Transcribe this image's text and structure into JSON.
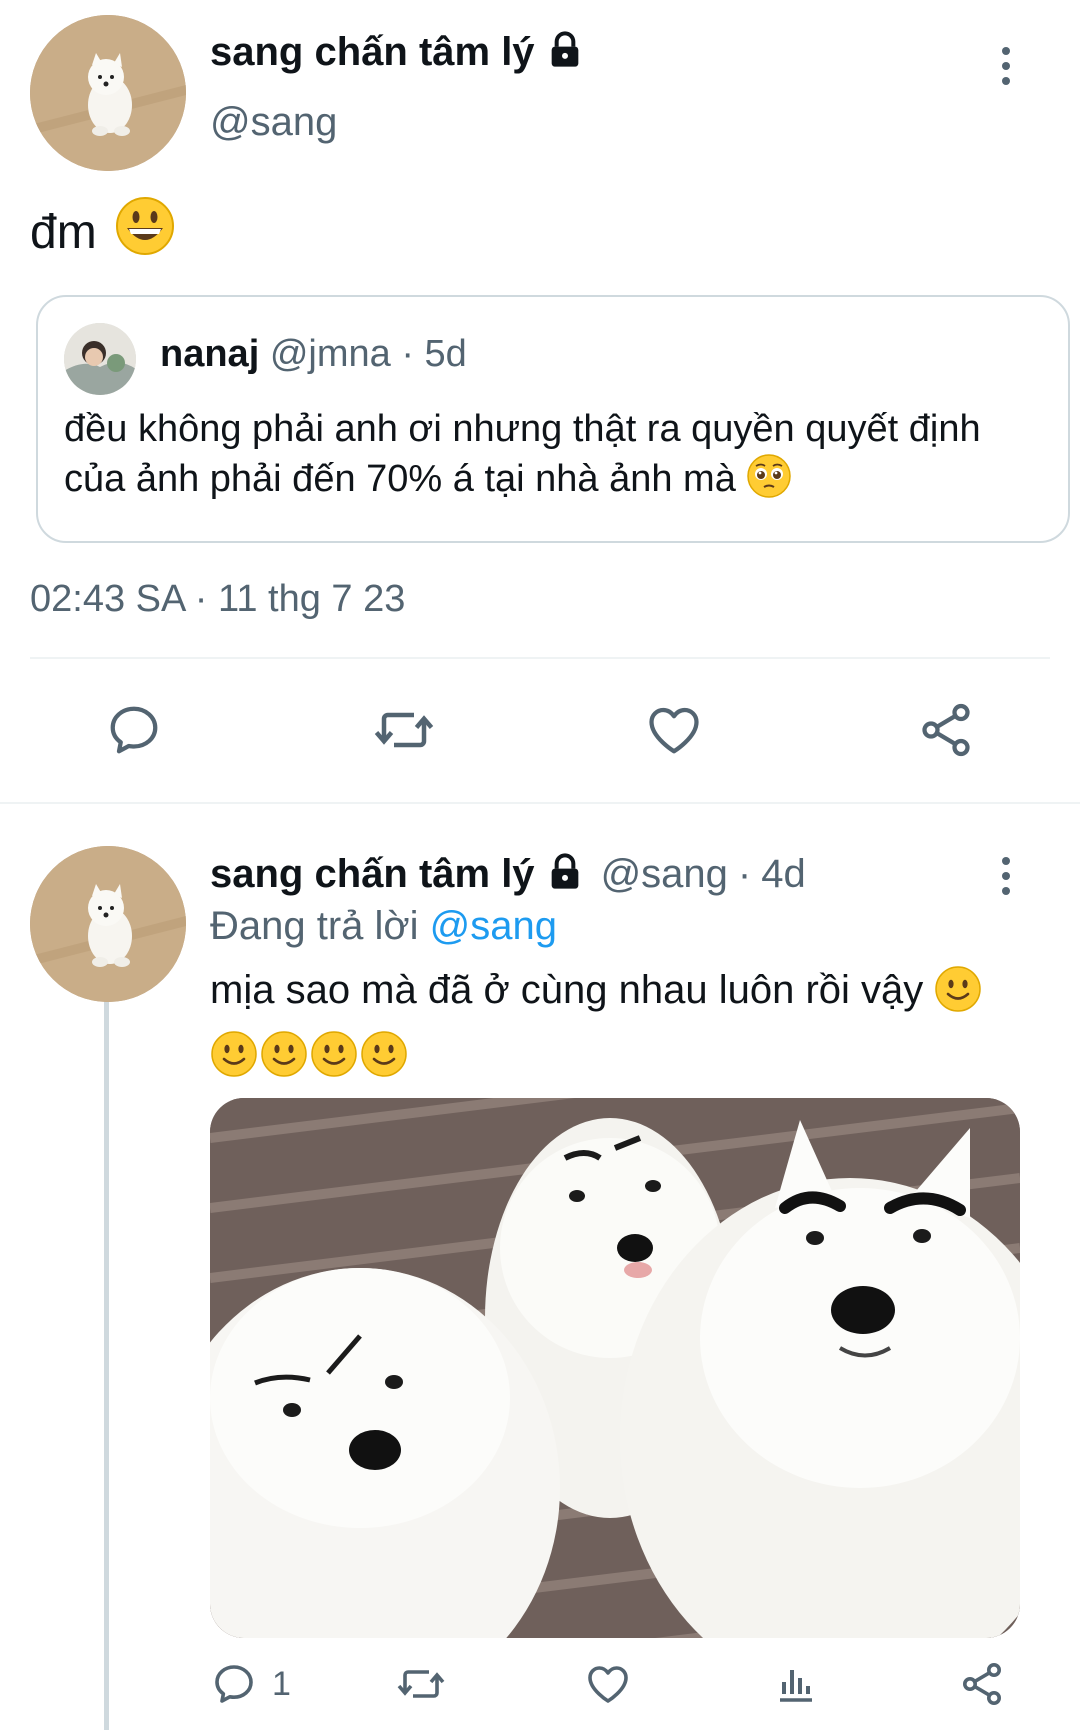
{
  "tweet1": {
    "author_name": "sang chấn tâm lý",
    "author_handle": "@sang",
    "text": "đm",
    "quoted": {
      "name": "nanaj",
      "handle": "@jmna",
      "sep": "·",
      "age": "5d",
      "text": "đều không phải anh ơi nhưng thật ra quyền quyết định của ảnh phải đến 70% á tại nhà ảnh mà"
    },
    "timestamp": "02:43 SA · 11 thg 7 23"
  },
  "tweet2": {
    "author_name": "sang chấn tâm lý",
    "author_handle": "@sang",
    "sep": "·",
    "age": "4d",
    "reply_prefix": "Đang trả lời",
    "reply_to": "@sang",
    "text_line1": "mịa sao mà đã ở cùng nhau luôn rồi vậy",
    "reply_count": "1"
  },
  "colors": {
    "text": "#0f1419",
    "secondary": "#536471",
    "link": "#1d9bf0",
    "border": "#cfd9de"
  },
  "icons": [
    "lock-icon",
    "more-icon",
    "reply-icon",
    "retweet-icon",
    "like-icon",
    "share-icon",
    "views-icon",
    "grinning-emoji",
    "pleading-emoji",
    "slight-smile-emoji"
  ]
}
